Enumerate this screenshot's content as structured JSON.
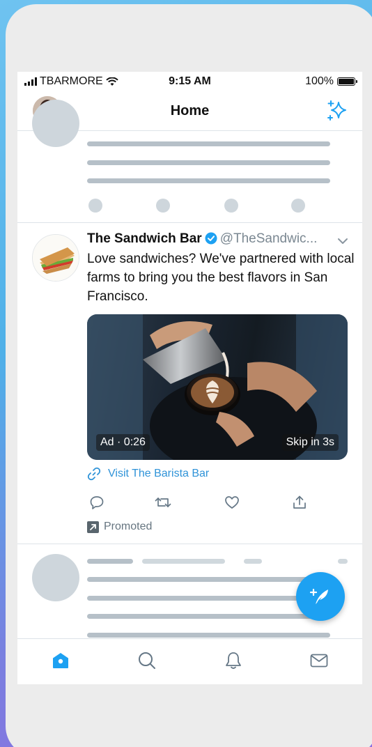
{
  "status_bar": {
    "carrier": "TBARMORE",
    "time": "9:15 AM",
    "battery": "100%"
  },
  "header": {
    "title": "Home",
    "avatar_icon": "profile-avatar",
    "sparkle_icon": "sparkle-icon"
  },
  "ad_tweet": {
    "name": "The Sandwich Bar",
    "handle": "@TheSandwic...",
    "text": "Love sandwiches? We've partnered with local farms to bring you the best flavors in San Francisco.",
    "media": {
      "ad_label": "Ad · 0:26",
      "skip_label": "Skip in 3s"
    },
    "link_text": "Visit The Barista Bar",
    "promoted_label": "Promoted"
  },
  "tabs": [
    "home",
    "search",
    "notifications",
    "messages"
  ],
  "colors": {
    "accent": "#1da1f2",
    "link": "#2f93d8",
    "skeleton": "#b6c0c8"
  }
}
